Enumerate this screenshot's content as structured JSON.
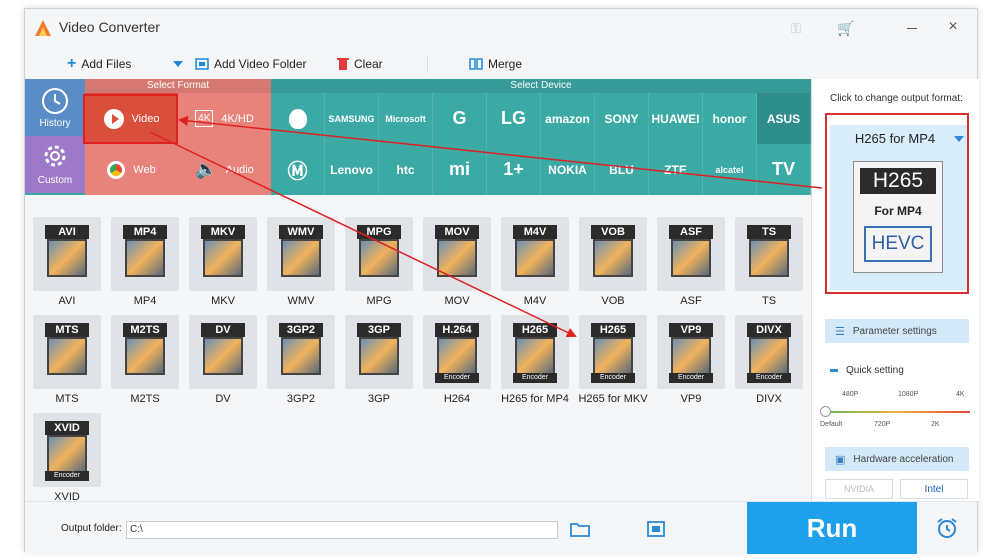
{
  "window": {
    "title": "Video Converter"
  },
  "toolbar": {
    "add_files": "Add Files",
    "add_video_folder": "Add Video Folder",
    "clear": "Clear",
    "merge": "Merge"
  },
  "categories": {
    "history": "History",
    "custom": "Custom"
  },
  "select_format": {
    "heading": "Select Format",
    "video": "Video",
    "fourk": "4K/HD",
    "web": "Web",
    "audio": "Audio"
  },
  "select_device": {
    "heading": "Select Device",
    "row1": [
      "",
      "SAMSUNG",
      "Microsoft",
      "G",
      "LG",
      "amazon",
      "SONY",
      "HUAWEI",
      "honor",
      "ASUS"
    ],
    "row2": [
      "",
      "Lenovo",
      "htc",
      "mi",
      "1+",
      "NOKIA",
      "BLU",
      "ZTE",
      "alcatel",
      "TV"
    ]
  },
  "formats": {
    "row1": [
      {
        "badge": "AVI",
        "name": "AVI"
      },
      {
        "badge": "MP4",
        "name": "MP4"
      },
      {
        "badge": "MKV",
        "name": "MKV"
      },
      {
        "badge": "WMV",
        "name": "WMV"
      },
      {
        "badge": "MPG",
        "name": "MPG"
      },
      {
        "badge": "MOV",
        "name": "MOV"
      },
      {
        "badge": "M4V",
        "name": "M4V"
      },
      {
        "badge": "VOB",
        "name": "VOB"
      },
      {
        "badge": "ASF",
        "name": "ASF"
      },
      {
        "badge": "TS",
        "name": "TS"
      }
    ],
    "row2": [
      {
        "badge": "MTS",
        "name": "MTS"
      },
      {
        "badge": "M2TS",
        "name": "M2TS"
      },
      {
        "badge": "DV",
        "name": "DV"
      },
      {
        "badge": "3GP2",
        "name": "3GP2"
      },
      {
        "badge": "3GP",
        "name": "3GP"
      },
      {
        "badge": "H.264",
        "name": "H264",
        "encoder": "Encoder"
      },
      {
        "badge": "H265",
        "name": "H265 for MP4",
        "encoder": "Encoder"
      },
      {
        "badge": "H265",
        "name": "H265 for MKV",
        "encoder": "Encoder"
      },
      {
        "badge": "VP9",
        "name": "VP9",
        "encoder": "Encoder"
      },
      {
        "badge": "DIVX",
        "name": "DIVX",
        "encoder": "Encoder"
      }
    ],
    "row3": [
      {
        "badge": "XVID",
        "name": "XVID",
        "encoder": "Encoder"
      }
    ]
  },
  "output": {
    "label": "Click to change output format:",
    "selected": "H265 for MP4",
    "icon_top": "H265",
    "icon_mid": "For MP4",
    "icon_codec": "HEVC"
  },
  "settings": {
    "parameter": "Parameter settings",
    "quick": "Quick setting",
    "ticks_top": [
      "480P",
      "1080P",
      "4K"
    ],
    "ticks_bottom": [
      "Default",
      "720P",
      "2K"
    ],
    "hardware": "Hardware acceleration",
    "nvidia": "NVIDIA",
    "intel": "Intel"
  },
  "bottom": {
    "output_folder_label": "Output folder:",
    "output_folder_value": "C:\\",
    "run": "Run"
  },
  "colors": {
    "run": "#1ea0ea",
    "format_section": "#e8837b",
    "video_active": "#d94f3c",
    "device_section": "#3ba9a4",
    "highlight": "#e02020"
  }
}
